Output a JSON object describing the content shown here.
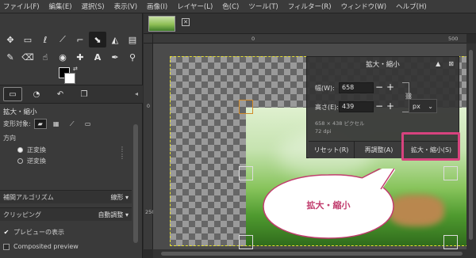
{
  "menubar": {
    "items": [
      "ファイル(F)",
      "編集(E)",
      "選択(S)",
      "表示(V)",
      "画像(I)",
      "レイヤー(L)",
      "色(C)",
      "ツール(T)",
      "フィルター(R)",
      "ウィンドウ(W)",
      "ヘルプ(H)"
    ]
  },
  "toolbox": {
    "row1": [
      "move-icon",
      "rect-select-icon",
      "lasso-icon",
      "fuzzy-select-icon",
      "crop-icon",
      "scale-tool-icon",
      "bucket-icon",
      "gradient-icon"
    ],
    "row2": [
      "brush-icon",
      "eraser-icon",
      "smudge-icon",
      "clone-icon",
      "heal-icon",
      "text-icon",
      "picker-icon",
      "zoom-icon"
    ]
  },
  "tool_options": {
    "title": "拡大・縮小",
    "transform_label": "変形対象:",
    "direction_label": "方向",
    "direction_normal": "正変換",
    "direction_reverse": "逆変換",
    "interpolation_label": "補間アルゴリズム",
    "interpolation_value": "線形",
    "clipping_label": "クリッピング",
    "clipping_value": "自動調整",
    "preview_label": "プレビューの表示",
    "composited_label": "Composited preview"
  },
  "ruler": {
    "h_labels": [
      "0",
      "500"
    ],
    "v_labels": [
      "0",
      "250"
    ]
  },
  "dialog": {
    "title": "拡大・縮小",
    "width_label": "幅(W):",
    "width_value": "658",
    "height_label": "高さ(E):",
    "height_value": "439",
    "unit": "px",
    "size_info": "658 × 438 ピクセル",
    "dpi_info": "72 dpi",
    "reset_button": "リセット(R)",
    "readjust_button": "再調整(A)",
    "scale_button": "拡大・縮小(S)"
  },
  "callout": {
    "text": "拡大・縮小"
  },
  "colors": {
    "highlight": "#d7437e",
    "callout_text": "#c13d6e",
    "selection_dash": "#e6e032"
  }
}
